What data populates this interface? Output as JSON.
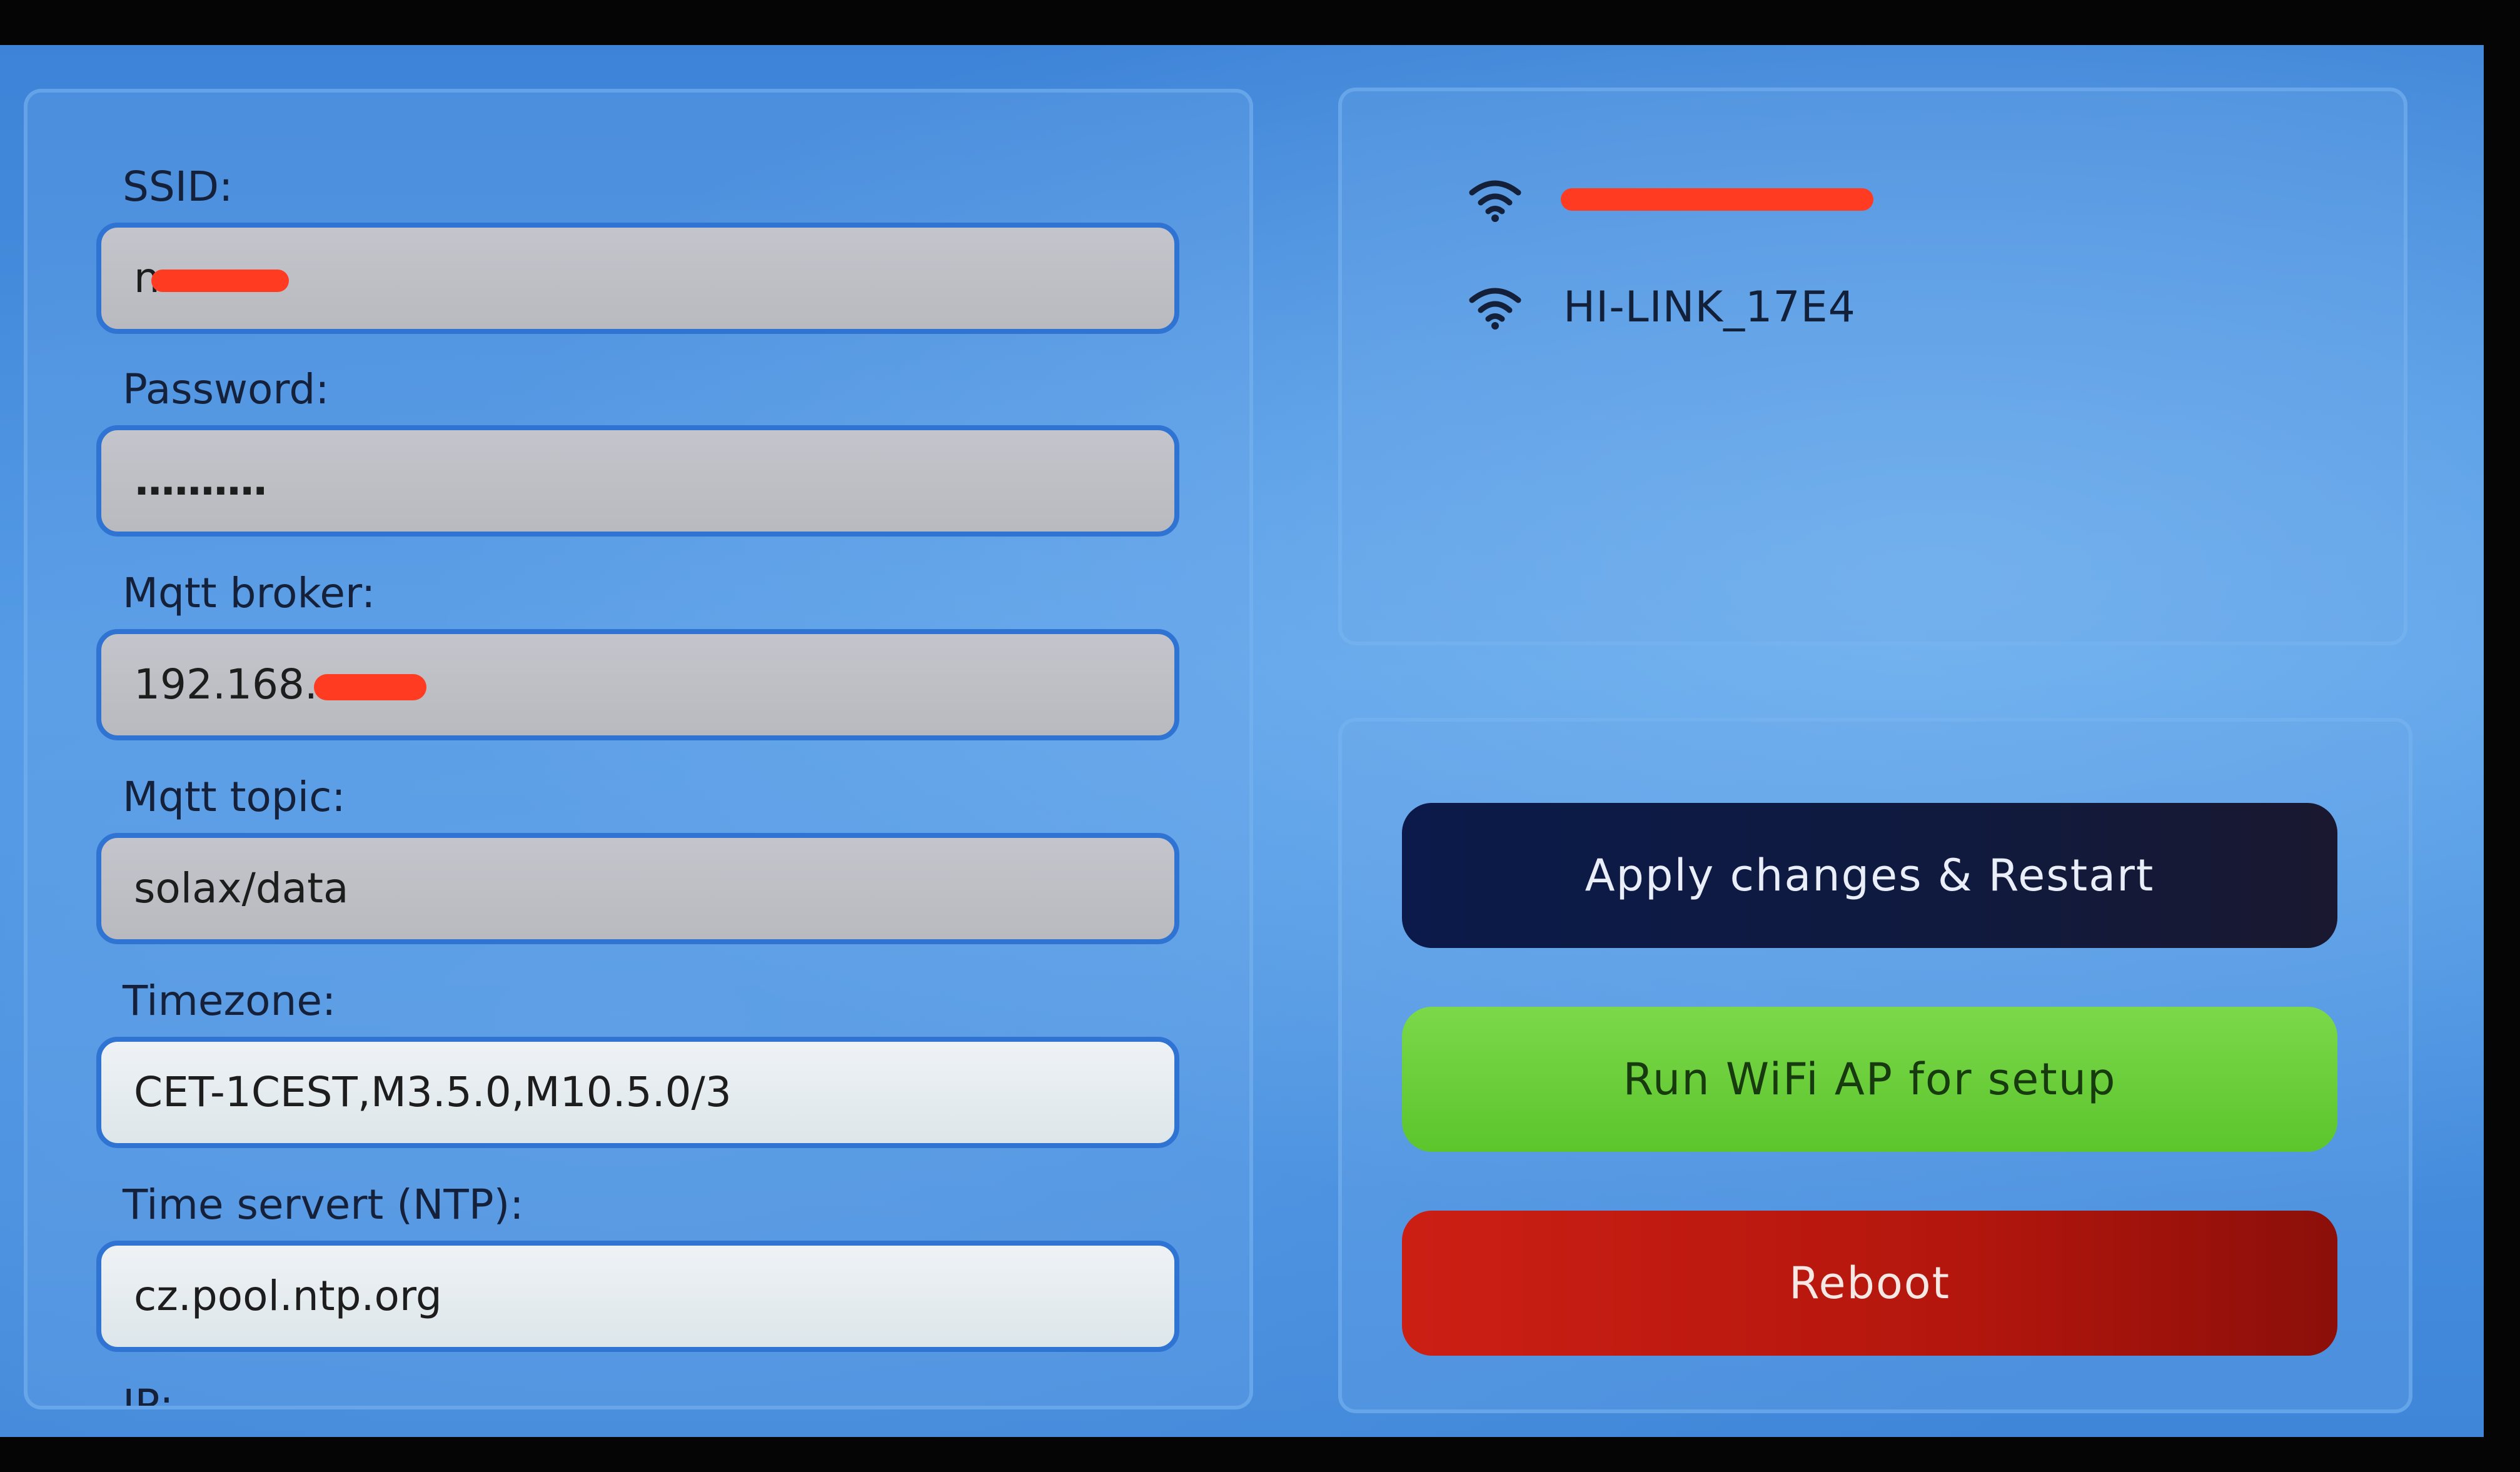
{
  "form": {
    "ssid_label": "SSID:",
    "ssid_value": "n",
    "password_label": "Password:",
    "password_value": "..........",
    "mqtt_broker_label": "Mqtt broker:",
    "mqtt_broker_value": "192.168.",
    "mqtt_topic_label": "Mqtt topic:",
    "mqtt_topic_value": "solax/data",
    "timezone_label": "Timezone:",
    "timezone_value": "CET-1CEST,M3.5.0,M10.5.0/3",
    "ntp_label": "Time servert (NTP):",
    "ntp_value": "cz.pool.ntp.org",
    "ip_label": "IP:"
  },
  "networks": [
    {
      "ssid": "",
      "icon": "wifi-icon"
    },
    {
      "ssid": "HI-LINK_17E4",
      "icon": "wifi-icon"
    }
  ],
  "actions": {
    "apply_label": "Apply changes & Restart",
    "wifi_ap_label": "Run WiFi AP for setup",
    "reboot_label": "Reboot"
  },
  "colors": {
    "apply_button": "#0b1a4a",
    "wifi_ap_button": "#6ccf3a",
    "reboot_button": "#c41b12",
    "redaction": "#ff3b22"
  }
}
